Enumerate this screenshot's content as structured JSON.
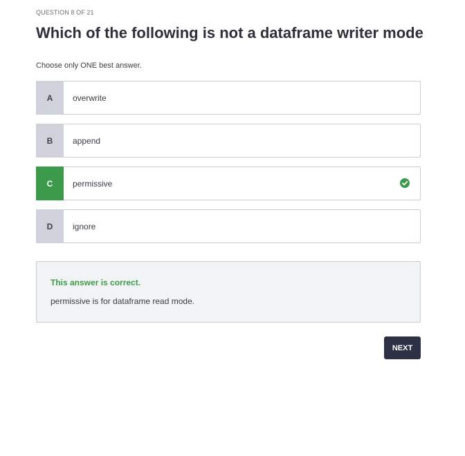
{
  "question": {
    "counter": "QUESTION 8 OF 21",
    "title": "Which of the following is not a dataframe writer mode",
    "instruction": "Choose only ONE best answer."
  },
  "options": [
    {
      "letter": "A",
      "text": "overwrite",
      "state": "default"
    },
    {
      "letter": "B",
      "text": "append",
      "state": "default"
    },
    {
      "letter": "C",
      "text": "permissive",
      "state": "correct",
      "icon": "check-circle-icon"
    },
    {
      "letter": "D",
      "text": "ignore",
      "state": "default"
    }
  ],
  "feedback": {
    "heading": "This answer is correct.",
    "explanation": "permissive is for dataframe read mode."
  },
  "actions": {
    "next_label": "NEXT"
  },
  "colors": {
    "correct_green": "#3b9b4a",
    "letter_gray": "#cfd2da",
    "button_dark": "#2e3146",
    "feedback_bg": "#f2f3f5"
  }
}
